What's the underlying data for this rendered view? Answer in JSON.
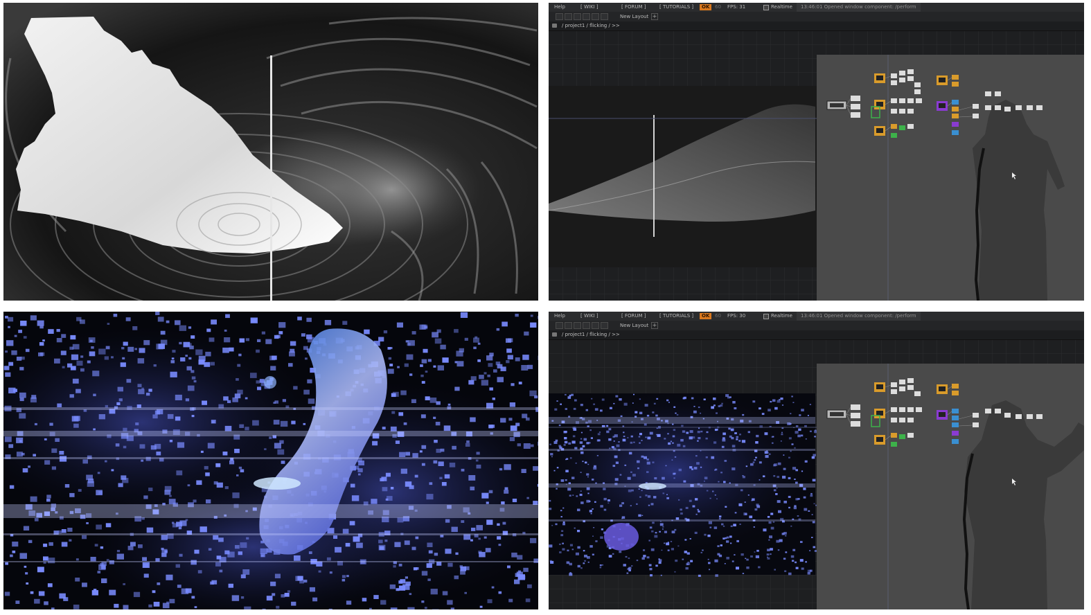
{
  "toolbar": {
    "help": "Help",
    "wiki": "[ WIKI ]",
    "forum": "[ FORUM ]",
    "tutorials": "[ TUTORIALS ]",
    "ok_badge": "OK",
    "sixty": "60",
    "realtime": "Realtime"
  },
  "layout": {
    "name": "New Layout",
    "add": "+"
  },
  "path": {
    "text": "/ project1 / flicking / >>"
  },
  "top_right": {
    "fps": "FPS:  31",
    "status": "13:46:01 Opened window component: /perform"
  },
  "bottom_right": {
    "fps": "FPS:  30",
    "status": "13:46:01 Opened window component: /perform"
  },
  "icons": [
    "home-icon",
    "realtime-checkbox-icon",
    "pane-layout-icon",
    "mouse-cursor-icon"
  ],
  "colors": {
    "menubar": "#2b2c2e",
    "ok_badge": "#d9781e",
    "particle_blue": "#7a8cff",
    "node_orange": "#d99b2b",
    "node_purple": "#8a3bd1",
    "node_green": "#3db24a",
    "node_blue": "#3a8fd1"
  }
}
